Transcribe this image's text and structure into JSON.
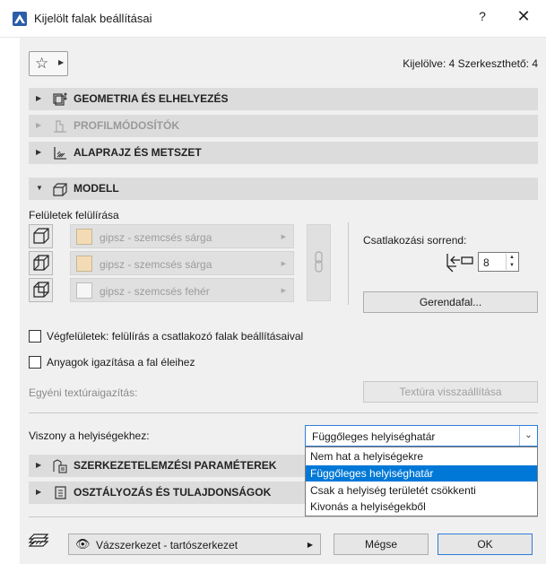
{
  "window": {
    "title": "Kijelölt falak beállításai",
    "help": "?",
    "close": "✕"
  },
  "header": {
    "favorites_icon": "star-icon",
    "selection_info": "Kijelölve: 4 Szerkeszthető: 4"
  },
  "sections": [
    {
      "title": "GEOMETRIA ÉS ELHELYEZÉS",
      "icon": "geometry-icon",
      "state": "collapsed"
    },
    {
      "title": "PROFILMÓDOSÍTÓK",
      "icon": "profile-icon",
      "state": "disabled"
    },
    {
      "title": "ALAPRAJZ ÉS METSZET",
      "icon": "floorplan-icon",
      "state": "collapsed"
    },
    {
      "title": "MODELL",
      "icon": "model-icon",
      "state": "expanded"
    },
    {
      "title": "SZERKEZETELEMZÉSI PARAMÉTEREK",
      "icon": "structural-icon",
      "state": "collapsed"
    },
    {
      "title": "OSZTÁLYOZÁS ÉS TULAJDONSÁGOK",
      "icon": "classification-icon",
      "state": "collapsed"
    }
  ],
  "model": {
    "surface_override_label": "Felületek felülírása",
    "materials": [
      {
        "name": "gipsz - szemcsés sárga",
        "color": "#f3dcb5"
      },
      {
        "name": "gipsz - szemcsés sárga",
        "color": "#f3dcb5"
      },
      {
        "name": "gipsz - szemcsés fehér",
        "color": "#f6f6f6"
      }
    ],
    "connection_order_label": "Csatlakozási sorrend:",
    "connection_order_value": "8",
    "log_wall_button": "Gerendafal...",
    "end_surfaces_checkbox": "Végfelületek: felülírás a csatlakozó falak beállításaival",
    "align_materials_checkbox": "Anyagok igazítása a fal éleihez",
    "custom_texture_label": "Egyéni textúraigazítás:",
    "reset_texture_button": "Textúra visszaállítása",
    "zones_relation_label": "Viszony a helyiségekhez:",
    "zones_relation_value": "Függőleges helyiséghatár",
    "zones_relation_options": [
      "Nem hat a helyiségekre",
      "Függőleges helyiséghatár",
      "Csak a helyiség területét csökkenti",
      "Kivonás a helyiségekből"
    ],
    "zones_relation_selected_index": 1
  },
  "footer": {
    "layer_icon": "layer-stack-icon",
    "view_label": "Vázszerkezet - tartószerkezet",
    "cancel_button": "Mégse",
    "ok_button": "OK"
  },
  "colors": {
    "accent": "#0078d7",
    "section_bg": "#dcdcdc",
    "panel_bg": "#f0f0f0"
  }
}
